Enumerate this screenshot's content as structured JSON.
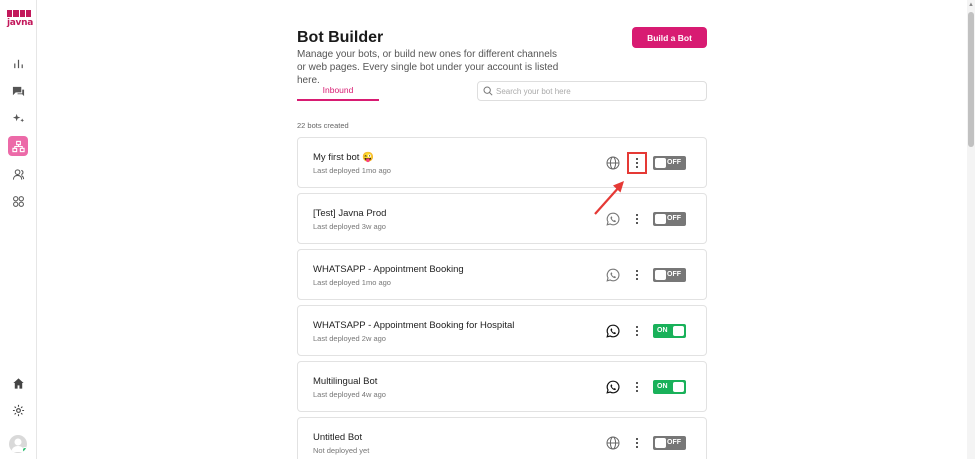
{
  "sidebar": {
    "logo_text": "javna",
    "items": [
      {
        "icon": "bar-chart-icon"
      },
      {
        "icon": "chat-icon"
      },
      {
        "icon": "sparkle-icon"
      },
      {
        "icon": "bot-builder-icon",
        "active": true
      },
      {
        "icon": "users-icon"
      },
      {
        "icon": "apps-icon"
      }
    ],
    "bottom": [
      {
        "icon": "home-icon"
      },
      {
        "icon": "settings-icon"
      },
      {
        "icon": "avatar-icon"
      }
    ]
  },
  "header": {
    "title": "Bot Builder",
    "subtitle": "Manage your bots, or build new ones for different channels or web pages. Every single bot under your account is listed here.",
    "build_button": "Build a Bot"
  },
  "tabs": [
    {
      "label": "Inbound",
      "active": true
    }
  ],
  "search": {
    "placeholder": "Search your bot here"
  },
  "bots_count": "22 bots created",
  "bots": [
    {
      "name": "My first bot 😜",
      "deployed": "Last deployed 1mo ago",
      "channel": "web-globe-icon",
      "status": "OFF"
    },
    {
      "name": "[Test] Javna Prod",
      "deployed": "Last deployed 3w ago",
      "channel": "whatsapp-icon",
      "status": "OFF"
    },
    {
      "name": "WHATSAPP - Appointment Booking",
      "deployed": "Last deployed 1mo ago",
      "channel": "whatsapp-icon",
      "status": "OFF"
    },
    {
      "name": "WHATSAPP - Appointment Booking for Hospital",
      "deployed": "Last deployed 2w ago",
      "channel": "whatsapp-icon",
      "status": "ON"
    },
    {
      "name": "Multilingual Bot",
      "deployed": "Last deployed 4w ago",
      "channel": "whatsapp-icon",
      "status": "ON"
    },
    {
      "name": "Untitled Bot",
      "deployed": "Not deployed yet",
      "channel": "web-globe-icon",
      "status": "OFF"
    }
  ],
  "colors": {
    "accent": "#d81b72",
    "toggle_on": "#19b15a",
    "toggle_off": "#777777",
    "highlight": "#e53935"
  }
}
